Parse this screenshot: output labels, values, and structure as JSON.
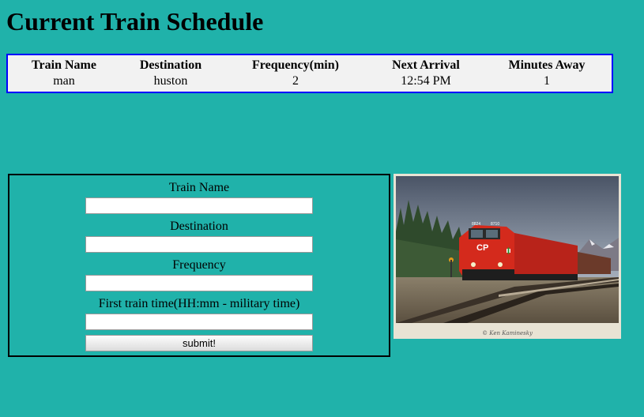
{
  "page": {
    "title": "Current Train Schedule"
  },
  "schedule": {
    "headers": [
      "Train Name",
      "Destination",
      "Frequency(min)",
      "Next Arrival",
      "Minutes Away"
    ],
    "rows": [
      [
        "man",
        "huston",
        "2",
        "12:54 PM",
        "1"
      ]
    ]
  },
  "form": {
    "train_name_label": "Train Name",
    "train_name_value": "",
    "destination_label": "Destination",
    "destination_value": "",
    "frequency_label": "Frequency",
    "frequency_value": "",
    "first_time_label": "First train time(HH:mm - military time)",
    "first_time_value": "",
    "submit_label": "submit!"
  },
  "image": {
    "caption": "© Ken Kaminesky",
    "locomotive_numbers": [
      "8824",
      "8710"
    ],
    "logo": "CP"
  },
  "colors": {
    "background": "#20b2aa",
    "table_border": "#0000ff",
    "table_bg": "#f2f2f2",
    "locomotive_red": "#d42a1c"
  }
}
